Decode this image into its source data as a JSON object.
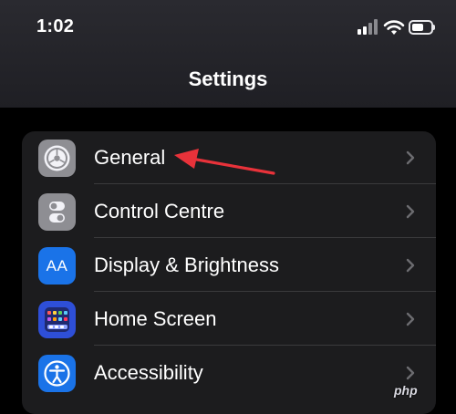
{
  "status_bar": {
    "time": "1:02"
  },
  "page": {
    "title": "Settings"
  },
  "settings_items": [
    {
      "label": "General",
      "icon": "gear-icon",
      "icon_color": "#8e8e93"
    },
    {
      "label": "Control Centre",
      "icon": "toggles-icon",
      "icon_color": "#8e8e93"
    },
    {
      "label": "Display & Brightness",
      "icon": "aa-text-icon",
      "icon_color": "#1a73e8",
      "icon_text": "AA"
    },
    {
      "label": "Home Screen",
      "icon": "home-grid-icon",
      "icon_color": "#2e4fd8"
    },
    {
      "label": "Accessibility",
      "icon": "accessibility-icon",
      "icon_color": "#1a73e8"
    }
  ],
  "annotation": {
    "arrow_color": "#e8323a"
  },
  "watermark": {
    "text": "php"
  }
}
